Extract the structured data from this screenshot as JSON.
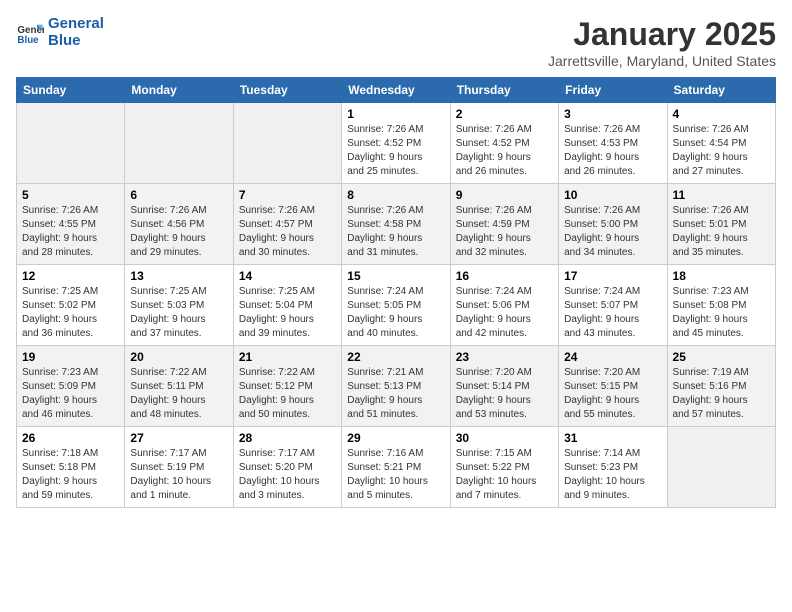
{
  "logo": {
    "line1": "General",
    "line2": "Blue"
  },
  "title": "January 2025",
  "subtitle": "Jarrettsville, Maryland, United States",
  "days_of_week": [
    "Sunday",
    "Monday",
    "Tuesday",
    "Wednesday",
    "Thursday",
    "Friday",
    "Saturday"
  ],
  "weeks": [
    [
      {
        "day": "",
        "detail": ""
      },
      {
        "day": "",
        "detail": ""
      },
      {
        "day": "",
        "detail": ""
      },
      {
        "day": "1",
        "detail": "Sunrise: 7:26 AM\nSunset: 4:52 PM\nDaylight: 9 hours\nand 25 minutes."
      },
      {
        "day": "2",
        "detail": "Sunrise: 7:26 AM\nSunset: 4:52 PM\nDaylight: 9 hours\nand 26 minutes."
      },
      {
        "day": "3",
        "detail": "Sunrise: 7:26 AM\nSunset: 4:53 PM\nDaylight: 9 hours\nand 26 minutes."
      },
      {
        "day": "4",
        "detail": "Sunrise: 7:26 AM\nSunset: 4:54 PM\nDaylight: 9 hours\nand 27 minutes."
      }
    ],
    [
      {
        "day": "5",
        "detail": "Sunrise: 7:26 AM\nSunset: 4:55 PM\nDaylight: 9 hours\nand 28 minutes."
      },
      {
        "day": "6",
        "detail": "Sunrise: 7:26 AM\nSunset: 4:56 PM\nDaylight: 9 hours\nand 29 minutes."
      },
      {
        "day": "7",
        "detail": "Sunrise: 7:26 AM\nSunset: 4:57 PM\nDaylight: 9 hours\nand 30 minutes."
      },
      {
        "day": "8",
        "detail": "Sunrise: 7:26 AM\nSunset: 4:58 PM\nDaylight: 9 hours\nand 31 minutes."
      },
      {
        "day": "9",
        "detail": "Sunrise: 7:26 AM\nSunset: 4:59 PM\nDaylight: 9 hours\nand 32 minutes."
      },
      {
        "day": "10",
        "detail": "Sunrise: 7:26 AM\nSunset: 5:00 PM\nDaylight: 9 hours\nand 34 minutes."
      },
      {
        "day": "11",
        "detail": "Sunrise: 7:26 AM\nSunset: 5:01 PM\nDaylight: 9 hours\nand 35 minutes."
      }
    ],
    [
      {
        "day": "12",
        "detail": "Sunrise: 7:25 AM\nSunset: 5:02 PM\nDaylight: 9 hours\nand 36 minutes."
      },
      {
        "day": "13",
        "detail": "Sunrise: 7:25 AM\nSunset: 5:03 PM\nDaylight: 9 hours\nand 37 minutes."
      },
      {
        "day": "14",
        "detail": "Sunrise: 7:25 AM\nSunset: 5:04 PM\nDaylight: 9 hours\nand 39 minutes."
      },
      {
        "day": "15",
        "detail": "Sunrise: 7:24 AM\nSunset: 5:05 PM\nDaylight: 9 hours\nand 40 minutes."
      },
      {
        "day": "16",
        "detail": "Sunrise: 7:24 AM\nSunset: 5:06 PM\nDaylight: 9 hours\nand 42 minutes."
      },
      {
        "day": "17",
        "detail": "Sunrise: 7:24 AM\nSunset: 5:07 PM\nDaylight: 9 hours\nand 43 minutes."
      },
      {
        "day": "18",
        "detail": "Sunrise: 7:23 AM\nSunset: 5:08 PM\nDaylight: 9 hours\nand 45 minutes."
      }
    ],
    [
      {
        "day": "19",
        "detail": "Sunrise: 7:23 AM\nSunset: 5:09 PM\nDaylight: 9 hours\nand 46 minutes."
      },
      {
        "day": "20",
        "detail": "Sunrise: 7:22 AM\nSunset: 5:11 PM\nDaylight: 9 hours\nand 48 minutes."
      },
      {
        "day": "21",
        "detail": "Sunrise: 7:22 AM\nSunset: 5:12 PM\nDaylight: 9 hours\nand 50 minutes."
      },
      {
        "day": "22",
        "detail": "Sunrise: 7:21 AM\nSunset: 5:13 PM\nDaylight: 9 hours\nand 51 minutes."
      },
      {
        "day": "23",
        "detail": "Sunrise: 7:20 AM\nSunset: 5:14 PM\nDaylight: 9 hours\nand 53 minutes."
      },
      {
        "day": "24",
        "detail": "Sunrise: 7:20 AM\nSunset: 5:15 PM\nDaylight: 9 hours\nand 55 minutes."
      },
      {
        "day": "25",
        "detail": "Sunrise: 7:19 AM\nSunset: 5:16 PM\nDaylight: 9 hours\nand 57 minutes."
      }
    ],
    [
      {
        "day": "26",
        "detail": "Sunrise: 7:18 AM\nSunset: 5:18 PM\nDaylight: 9 hours\nand 59 minutes."
      },
      {
        "day": "27",
        "detail": "Sunrise: 7:17 AM\nSunset: 5:19 PM\nDaylight: 10 hours\nand 1 minute."
      },
      {
        "day": "28",
        "detail": "Sunrise: 7:17 AM\nSunset: 5:20 PM\nDaylight: 10 hours\nand 3 minutes."
      },
      {
        "day": "29",
        "detail": "Sunrise: 7:16 AM\nSunset: 5:21 PM\nDaylight: 10 hours\nand 5 minutes."
      },
      {
        "day": "30",
        "detail": "Sunrise: 7:15 AM\nSunset: 5:22 PM\nDaylight: 10 hours\nand 7 minutes."
      },
      {
        "day": "31",
        "detail": "Sunrise: 7:14 AM\nSunset: 5:23 PM\nDaylight: 10 hours\nand 9 minutes."
      },
      {
        "day": "",
        "detail": ""
      }
    ]
  ]
}
